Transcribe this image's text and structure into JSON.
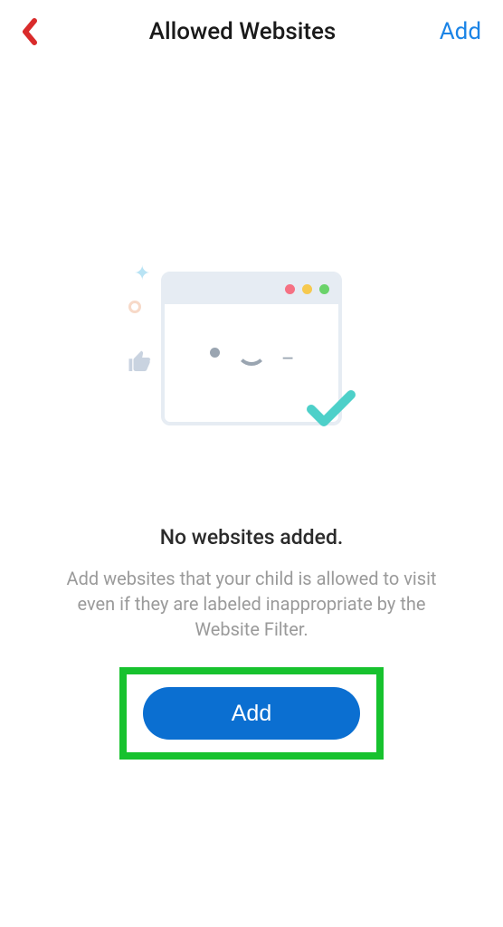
{
  "header": {
    "title": "Allowed Websites",
    "add_link": "Add"
  },
  "empty_state": {
    "title": "No websites added.",
    "description": "Add websites that your child is allowed to visit even if they are labeled inappropriate by the Website Filter.",
    "button_label": "Add"
  },
  "icons": {
    "back": "back-chevron",
    "thumb": "thumbs-up",
    "check": "checkmark"
  }
}
